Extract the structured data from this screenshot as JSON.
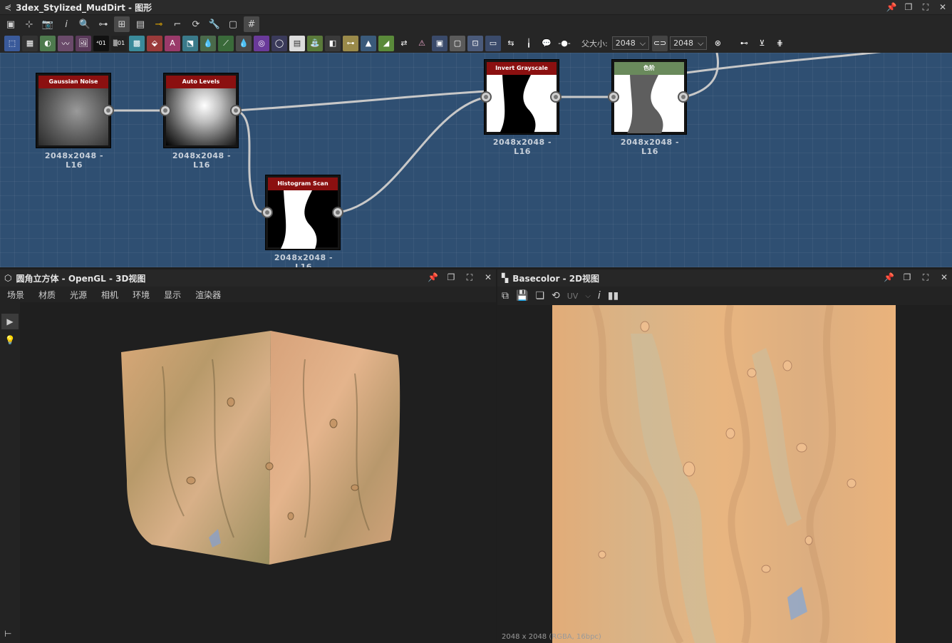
{
  "window": {
    "title": "3dex_Stylized_MudDirt - 图形"
  },
  "toolbar2": {
    "parent_size_label": "父大小:",
    "width_value": "2048",
    "height_value": "2048"
  },
  "graph": {
    "nodes": [
      {
        "name": "Gaussian Noise",
        "label": "2048x2048 - L16"
      },
      {
        "name": "Auto Levels",
        "label": "2048x2048 - L16"
      },
      {
        "name": "Histogram Scan",
        "label": "2048x2048 - L16"
      },
      {
        "name": "Invert Grayscale",
        "label": "2048x2048 - L16"
      },
      {
        "name": "色阶",
        "label": "2048x2048 - L16"
      }
    ]
  },
  "view3d": {
    "title": "圆角立方体 - OpenGL - 3D视图",
    "menu": [
      "场景",
      "材质",
      "光源",
      "相机",
      "环境",
      "显示",
      "渲染器"
    ]
  },
  "view2d": {
    "title": "Basecolor - 2D视图",
    "uv_label": "UV",
    "status": "2048 x 2048 (RGBA, 16bpc)"
  },
  "colors": {
    "graph_bg": "#2f4f72",
    "node_header": "#8b1010",
    "node_header_levels": "#6a8a5c"
  }
}
